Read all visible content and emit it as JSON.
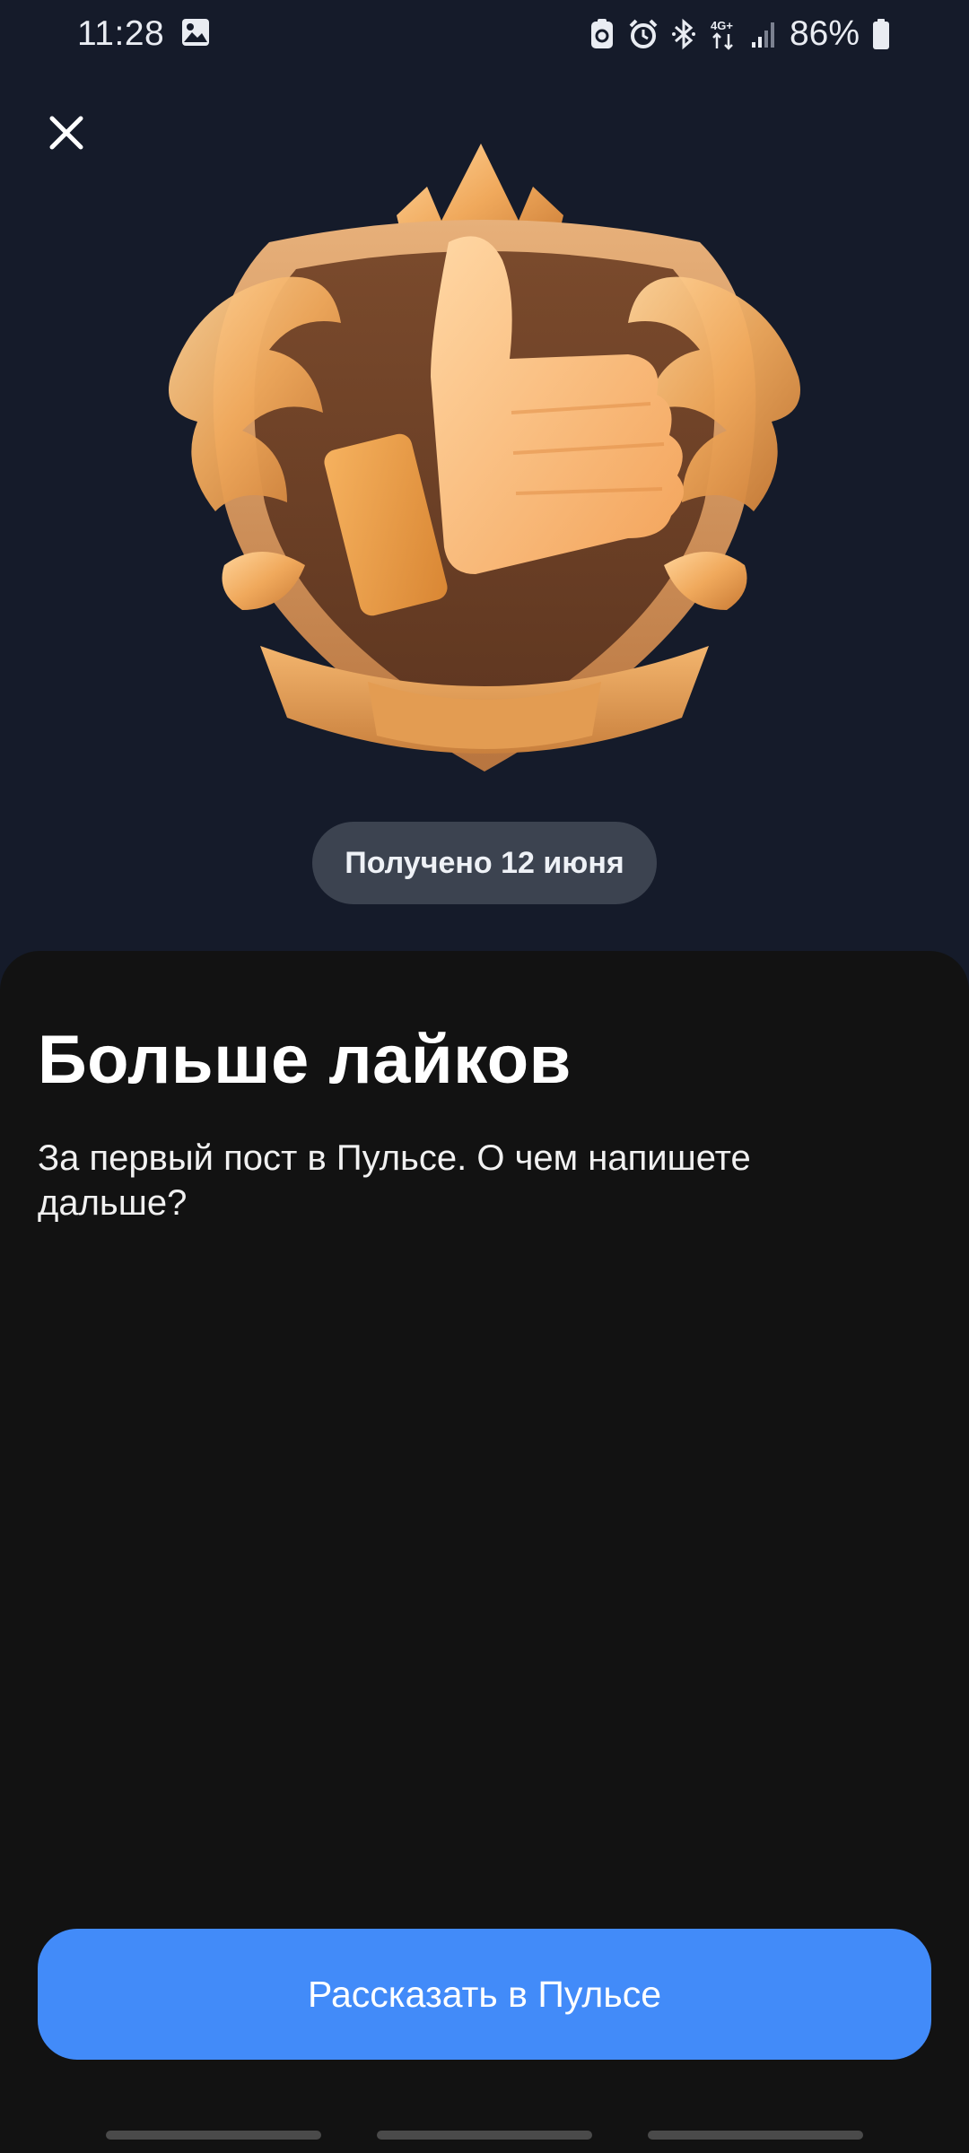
{
  "status_bar": {
    "time": "11:28",
    "battery": "86%",
    "icons": [
      "gallery-icon",
      "battery-saver-icon",
      "alarm-icon",
      "bluetooth-icon",
      "network-4g-icon",
      "signal-icon",
      "battery-icon"
    ],
    "network_label": "4G+"
  },
  "badge": {
    "icon": "thumbs-up-crest",
    "received_label": "Получено 12 июня"
  },
  "content": {
    "title": "Больше лайков",
    "description": "За первый пост в Пульсе. О чем напишете дальше?"
  },
  "actions": {
    "close_icon": "close-icon",
    "cta_label": "Рассказать в Пульсе"
  },
  "colors": {
    "background": "#151b2a",
    "sheet": "#121212",
    "accent": "#428bf9",
    "pill": "#3c4350",
    "gold": "#d99a55"
  }
}
